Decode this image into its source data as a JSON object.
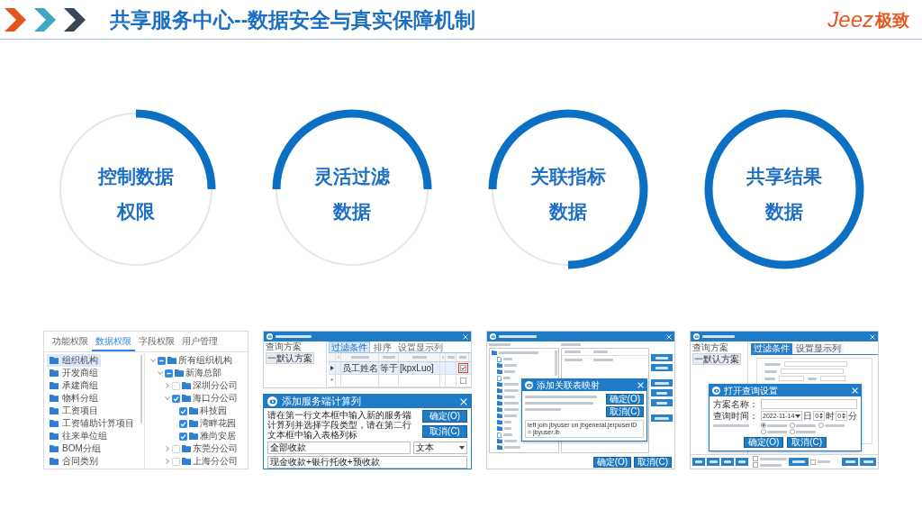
{
  "header": {
    "title": "共享服务中心--数据安全与真实保障机制",
    "logo": {
      "wordmark": "Jeez",
      "name": "极致"
    }
  },
  "rings": [
    {
      "lines": [
        "控制数据",
        "权限"
      ],
      "quarters": [
        {
          "filled": true
        },
        {
          "filled": false
        },
        {
          "filled": false
        },
        {
          "filled": false
        }
      ]
    },
    {
      "lines": [
        "灵活过滤",
        "数据"
      ],
      "quarters": [
        {
          "filled": true
        },
        {
          "filled": false
        },
        {
          "filled": false
        },
        {
          "filled": true
        }
      ]
    },
    {
      "lines": [
        "关联指标",
        "数据"
      ],
      "quarters": [
        {
          "filled": true
        },
        {
          "filled": true
        },
        {
          "filled": false
        },
        {
          "filled": true
        }
      ]
    },
    {
      "lines": [
        "共享结果",
        "数据"
      ],
      "quarters": [
        {
          "filled": true
        },
        {
          "filled": true
        },
        {
          "filled": true
        },
        {
          "filled": true
        }
      ]
    }
  ],
  "screenshots": [
    {
      "kind": "permissions",
      "tabs": [
        {
          "label": "功能权限",
          "selected": false
        },
        {
          "label": "数据权限",
          "selected": true
        },
        {
          "label": "字段权限",
          "selected": false
        },
        {
          "label": "用户管理",
          "selected": false
        }
      ],
      "groups": [
        {
          "label": "组织机构",
          "selected": true
        },
        {
          "label": "开发商组",
          "selected": false
        },
        {
          "label": "承建商组",
          "selected": false
        },
        {
          "label": "物料分组",
          "selected": false
        },
        {
          "label": "工资项目",
          "selected": false
        },
        {
          "label": "工资辅助计算项目",
          "selected": false
        },
        {
          "label": "往来单位组",
          "selected": false
        },
        {
          "label": "BOM分组",
          "selected": false
        },
        {
          "label": "合同类别",
          "selected": false
        }
      ],
      "tree": [
        {
          "label": "所有组织机构",
          "checked": false,
          "partial": true,
          "expanded": true,
          "children": [
            {
              "label": "新海总部",
              "checked": false,
              "partial": true,
              "expanded": true,
              "children": [
                {
                  "label": "深圳分公司",
                  "checked": false,
                  "partial": false,
                  "expanded": false
                },
                {
                  "label": "海口分公司",
                  "checked": true,
                  "partial": false,
                  "expanded": true,
                  "children": [
                    {
                      "label": "科技园",
                      "checked": true,
                      "partial": false
                    },
                    {
                      "label": "湾畔花园",
                      "checked": true,
                      "partial": false
                    },
                    {
                      "label": "雅尚安居",
                      "checked": true,
                      "partial": false
                    }
                  ]
                },
                {
                  "label": "东莞分公司",
                  "checked": false,
                  "partial": false,
                  "expanded": false
                },
                {
                  "label": "上海分公司",
                  "checked": false,
                  "partial": false,
                  "expanded": false
                }
              ]
            }
          ]
        }
      ]
    },
    {
      "kind": "query",
      "window": {
        "schemes_label": "查询方案",
        "schemes": [
          {
            "label": "一默认方案",
            "selected": true
          }
        ],
        "tabs": [
          {
            "label": "过滤条件",
            "selected": true
          },
          {
            "label": "排序",
            "selected": false
          },
          {
            "label": "设置显示列",
            "selected": false
          }
        ],
        "rows": [
          {
            "current": true,
            "cells": [
              "员工姓名",
              "等于",
              "[kpxLuo]"
            ],
            "hidden": true,
            "highlighted": true
          },
          {
            "current": false,
            "marker": "*",
            "hidden": false,
            "highlighted": false
          }
        ]
      },
      "dialog": {
        "title": "添加服务端计算列",
        "message": "请在第一行文本框中输入新的服务端计算列并选择字段类型，请在第二行文本框中输入表格列标",
        "buttons": [
          "确定(O)",
          "取消(C)"
        ],
        "name_value": "全部收款",
        "type_value": "文本",
        "formula_value": "现金收款+银行托收+预收款"
      }
    },
    {
      "kind": "mapping",
      "dialog": {
        "title": "添加关联表映射",
        "buttons": [
          "确定(O)",
          "取消(C)"
        ],
        "sql": "left join jbyuser on jbgeneral.jerpuserID = jbyuser.ib"
      },
      "footer_buttons": [
        "确定(O)",
        "取消(C)"
      ]
    },
    {
      "kind": "settings",
      "schemes_label": "查询方案",
      "schemes": [
        {
          "label": "一默认方案",
          "selected": true
        }
      ],
      "tabs": [
        {
          "label": "过滤条件",
          "selected": true
        },
        {
          "label": "设置显示列",
          "selected": false
        }
      ],
      "dialog": {
        "title": "打开查询设置",
        "name_label": "方案名称：",
        "time_label": "查询时间：",
        "date": "2022-11-14",
        "day_unit": "日",
        "hour": "0",
        "hour_unit": "时",
        "minute": "0",
        "minute_unit": "分",
        "range_options": [
          {
            "selected": true
          },
          {
            "selected": false
          },
          {
            "selected": false
          },
          {
            "selected": false
          },
          {
            "selected": false
          }
        ],
        "buttons": [
          "确定(O)",
          "取消(C)"
        ]
      },
      "footer_checkboxes": [
        {
          "checked": false
        },
        {
          "checked": false
        },
        {
          "checked": false
        }
      ]
    }
  ]
}
